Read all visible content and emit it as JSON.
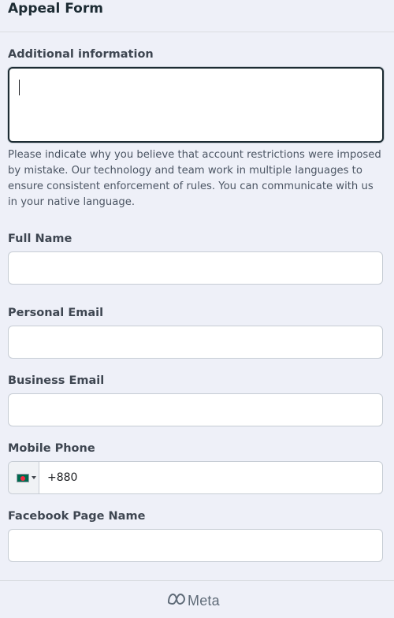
{
  "form": {
    "title": "Appeal Form",
    "fields": {
      "additional_info": {
        "label": "Additional information",
        "value": "",
        "helper": "Please indicate why you believe that account restrictions were imposed by mistake. Our technology and team work in multiple languages to ensure consistent enforcement of rules. You can communicate with us in your native language."
      },
      "full_name": {
        "label": "Full Name",
        "value": "",
        "placeholder": ""
      },
      "personal_email": {
        "label": "Personal Email",
        "value": "",
        "placeholder": ""
      },
      "business_email": {
        "label": "Business Email",
        "value": "",
        "placeholder": ""
      },
      "mobile_phone": {
        "label": "Mobile Phone",
        "country_flag": "bangladesh-flag-icon",
        "value": "+880"
      },
      "facebook_page": {
        "label": "Facebook Page Name",
        "value": "",
        "placeholder": ""
      }
    }
  },
  "footer": {
    "brand": "Meta",
    "brand_icon": "meta-infinity-icon"
  },
  "colors": {
    "background": "#eef0f8",
    "focus_border": "#1c2b33",
    "input_border": "#c6ccd4"
  }
}
